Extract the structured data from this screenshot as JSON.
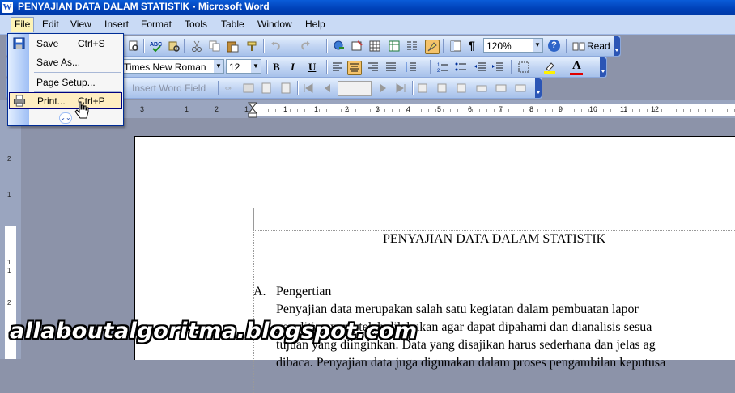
{
  "window": {
    "title": "PENYAJIAN DATA DALAM STATISTIK - Microsoft Word",
    "app_icon": "word-icon"
  },
  "menubar": {
    "items": [
      "File",
      "Edit",
      "View",
      "Insert",
      "Format",
      "Tools",
      "Table",
      "Window",
      "Help"
    ],
    "open": "File"
  },
  "toolbar_standard": {
    "zoom": "120%",
    "read_label": "Read"
  },
  "toolbar_formatting": {
    "font": "Times New Roman",
    "size": "12",
    "bold": "B",
    "italic": "I",
    "underline": "U",
    "font_color_label": "A"
  },
  "toolbar_mailmerge": {
    "insert_word_field": "Insert Word Field"
  },
  "ruler": {
    "numbers": [
      "3",
      "1",
      "2",
      "1",
      "1",
      "1",
      "2",
      "3",
      "4",
      "5",
      "6",
      "7",
      "8",
      "9",
      "10",
      "11",
      "12"
    ]
  },
  "vruler": {
    "numbers": [
      "2",
      "1",
      "1",
      "1",
      "2"
    ]
  },
  "file_menu": {
    "items": [
      {
        "label": "Save",
        "shortcut": "Ctrl+S",
        "icon": "save-icon"
      },
      {
        "label": "Save As...",
        "shortcut": ""
      },
      {
        "label": "Page Setup...",
        "shortcut": ""
      },
      {
        "label": "Print...",
        "shortcut": "Ctrl+P",
        "icon": "print-icon",
        "highlighted": true
      }
    ],
    "expand_icon": "double-chevron-down-icon"
  },
  "document": {
    "title": "PENYAJIAN DATA DALAM STATISTIK",
    "heading_num": "A.",
    "heading": "Pengertian",
    "lines": [
      "Penyajian data merupakan salah satu kegiatan dalam pembuatan lapor",
      "penelitian yang telah dilakukan agar dapat dipahami dan dianalisis sesua",
      "tujuan yang diinginkan. Data yang disajikan harus sederhana dan jelas ag",
      "dibaca. Penyajian data juga digunakan dalam proses pengambilan keputusa"
    ]
  },
  "watermark": "allaboutalgoritma.blogspot.com",
  "colors": {
    "titlebar": "#0A5CD8",
    "menubar": "#C9DAF5",
    "menu_highlight": "#FFEEC2",
    "workspace": "#8C93A9"
  }
}
